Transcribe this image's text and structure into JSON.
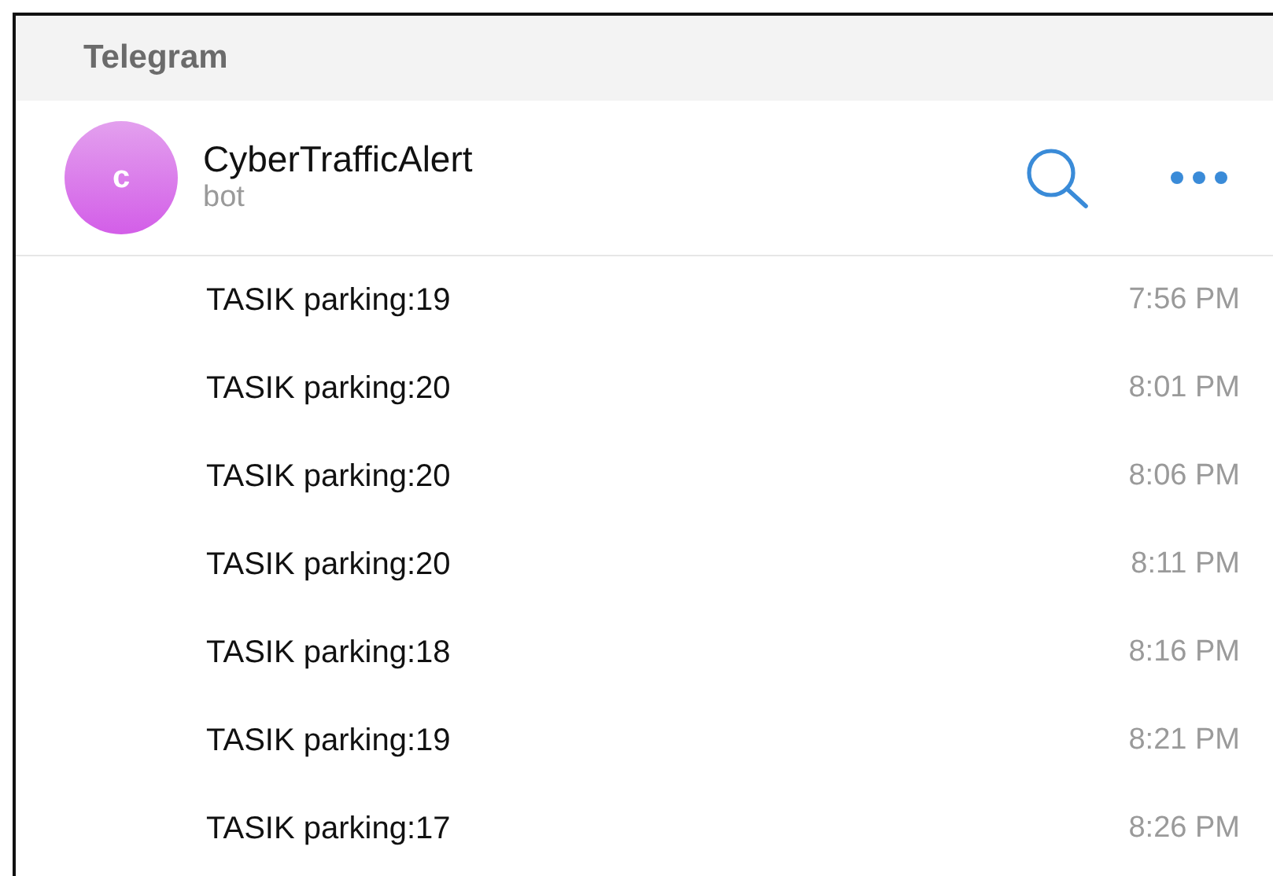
{
  "window": {
    "title": "Telegram"
  },
  "chat": {
    "avatar_letter": "c",
    "name": "CyberTrafficAlert",
    "subtitle": "bot"
  },
  "messages": [
    {
      "text": "TASIK parking:19",
      "time": "7:56 PM"
    },
    {
      "text": "TASIK parking:20",
      "time": "8:01 PM"
    },
    {
      "text": "TASIK parking:20",
      "time": "8:06 PM"
    },
    {
      "text": "TASIK parking:20",
      "time": "8:11 PM"
    },
    {
      "text": "TASIK parking:18",
      "time": "8:16 PM"
    },
    {
      "text": "TASIK parking:19",
      "time": "8:21 PM"
    },
    {
      "text": "TASIK parking:17",
      "time": "8:26 PM"
    }
  ]
}
